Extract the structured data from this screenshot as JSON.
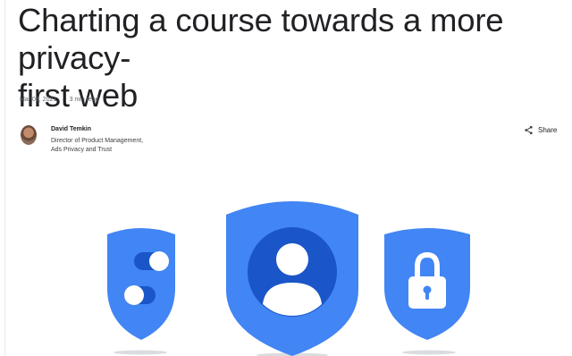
{
  "article": {
    "title_line1": "Charting a course towards a more privacy-",
    "title_line2": "first web",
    "date": "Mar 03, 2021",
    "read_time": "3 min read"
  },
  "author": {
    "name": "David Temkin",
    "role_line1": "Director of Product Management,",
    "role_line2": "Ads Privacy and Trust"
  },
  "actions": {
    "share_label": "Share"
  },
  "colors": {
    "shield_blue": "#4285f4",
    "shield_dark": "#1a56c8",
    "text_primary": "#202124",
    "text_secondary": "#5f6368"
  },
  "hero_icons": [
    "toggle-shield-icon",
    "person-shield-icon",
    "lock-shield-icon"
  ]
}
